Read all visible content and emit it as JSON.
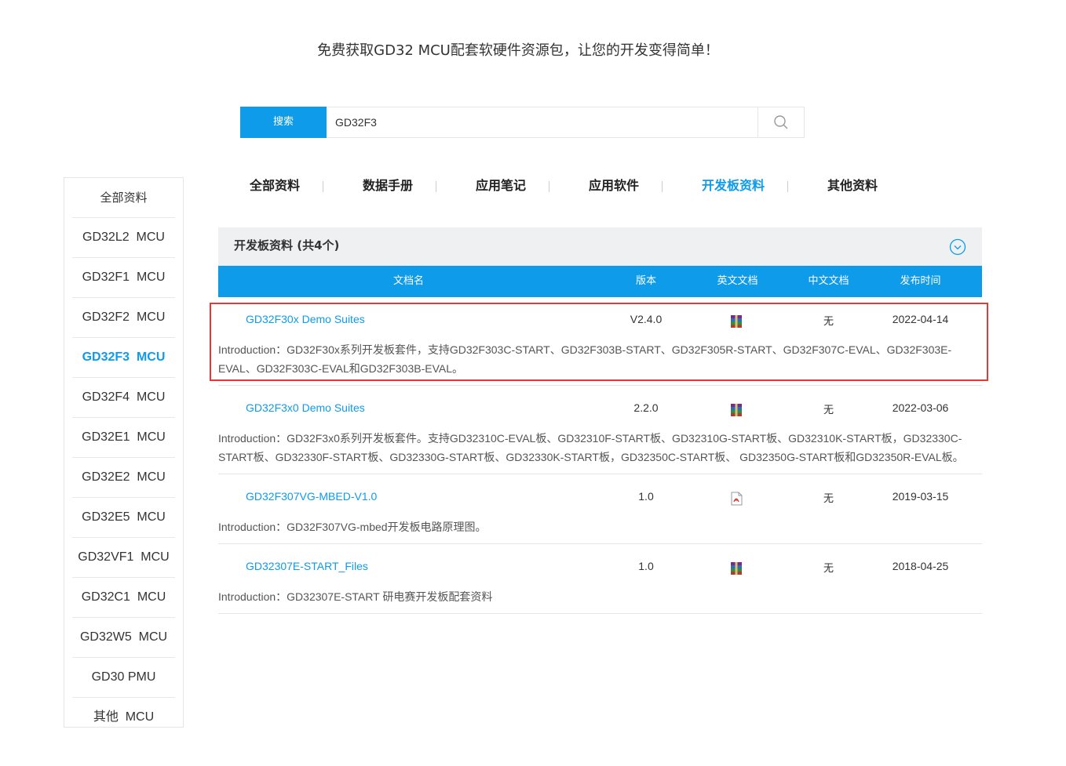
{
  "tagline": "免费获取GD32 MCU配套软硬件资源包，让您的开发变得简单！",
  "search": {
    "button_label": "搜索",
    "query": "GD32F3",
    "search_icon": "magnifier-icon"
  },
  "sidebar": {
    "items": [
      {
        "label": "全部资料"
      },
      {
        "label": "GD32L2  MCU"
      },
      {
        "label": "GD32F1  MCU"
      },
      {
        "label": "GD32F2  MCU"
      },
      {
        "label": "GD32F3  MCU",
        "active": true
      },
      {
        "label": "GD32F4  MCU"
      },
      {
        "label": "GD32E1  MCU"
      },
      {
        "label": "GD32E2  MCU"
      },
      {
        "label": "GD32E5  MCU"
      },
      {
        "label": "GD32VF1  MCU"
      },
      {
        "label": "GD32C1  MCU"
      },
      {
        "label": "GD32W5  MCU"
      },
      {
        "label": "GD30 PMU"
      },
      {
        "label": "其他  MCU"
      }
    ]
  },
  "tabs": [
    {
      "label": "全部资料"
    },
    {
      "label": "数据手册"
    },
    {
      "label": "应用笔记"
    },
    {
      "label": "应用软件"
    },
    {
      "label": "开发板资料",
      "active": true
    },
    {
      "label": "其他资料"
    }
  ],
  "section": {
    "title": "开发板资料 (共4个)",
    "toggle_icon": "chevron-down-circle-icon"
  },
  "table": {
    "headers": {
      "name": "文档名",
      "version": "版本",
      "en_doc": "英文文档",
      "cn_doc": "中文文档",
      "date": "发布时间"
    },
    "rows": [
      {
        "name": "GD32F30x Demo Suites",
        "version": "V2.4.0",
        "en_icon": "archive-icon",
        "cn_doc": "无",
        "date": "2022-04-14",
        "intro": "Introduction：GD32F30x系列开发板套件，支持GD32F303C-START、GD32F303B-START、GD32F305R-START、GD32F307C-EVAL、GD32F303E-EVAL、GD32F303C-EVAL和GD32F303B-EVAL。"
      },
      {
        "name": "GD32F3x0 Demo Suites",
        "version": "2.2.0",
        "en_icon": "archive-icon",
        "cn_doc": "无",
        "date": "2022-03-06",
        "intro": "Introduction：GD32F3x0系列开发板套件。支持GD32310C-EVAL板、GD32310F-START板、GD32310G-START板、GD32310K-START板，GD32330C-START板、GD32330F-START板、GD32330G-START板、GD32330K-START板，GD32350C-START板、 GD32350G-START板和GD32350R-EVAL板。"
      },
      {
        "name": "GD32F307VG-MBED-V1.0",
        "version": "1.0",
        "en_icon": "pdf-icon",
        "cn_doc": "无",
        "date": "2019-03-15",
        "intro": "Introduction：GD32F307VG-mbed开发板电路原理图。"
      },
      {
        "name": "GD32307E-START_Files",
        "version": "1.0",
        "en_icon": "archive-icon",
        "cn_doc": "无",
        "date": "2018-04-25",
        "intro": "Introduction：GD32307E-START 研电赛开发板配套资料"
      }
    ]
  },
  "colors": {
    "accent": "#0d9bea",
    "highlight_border": "#e53935",
    "section_bg": "#eef0f2"
  }
}
